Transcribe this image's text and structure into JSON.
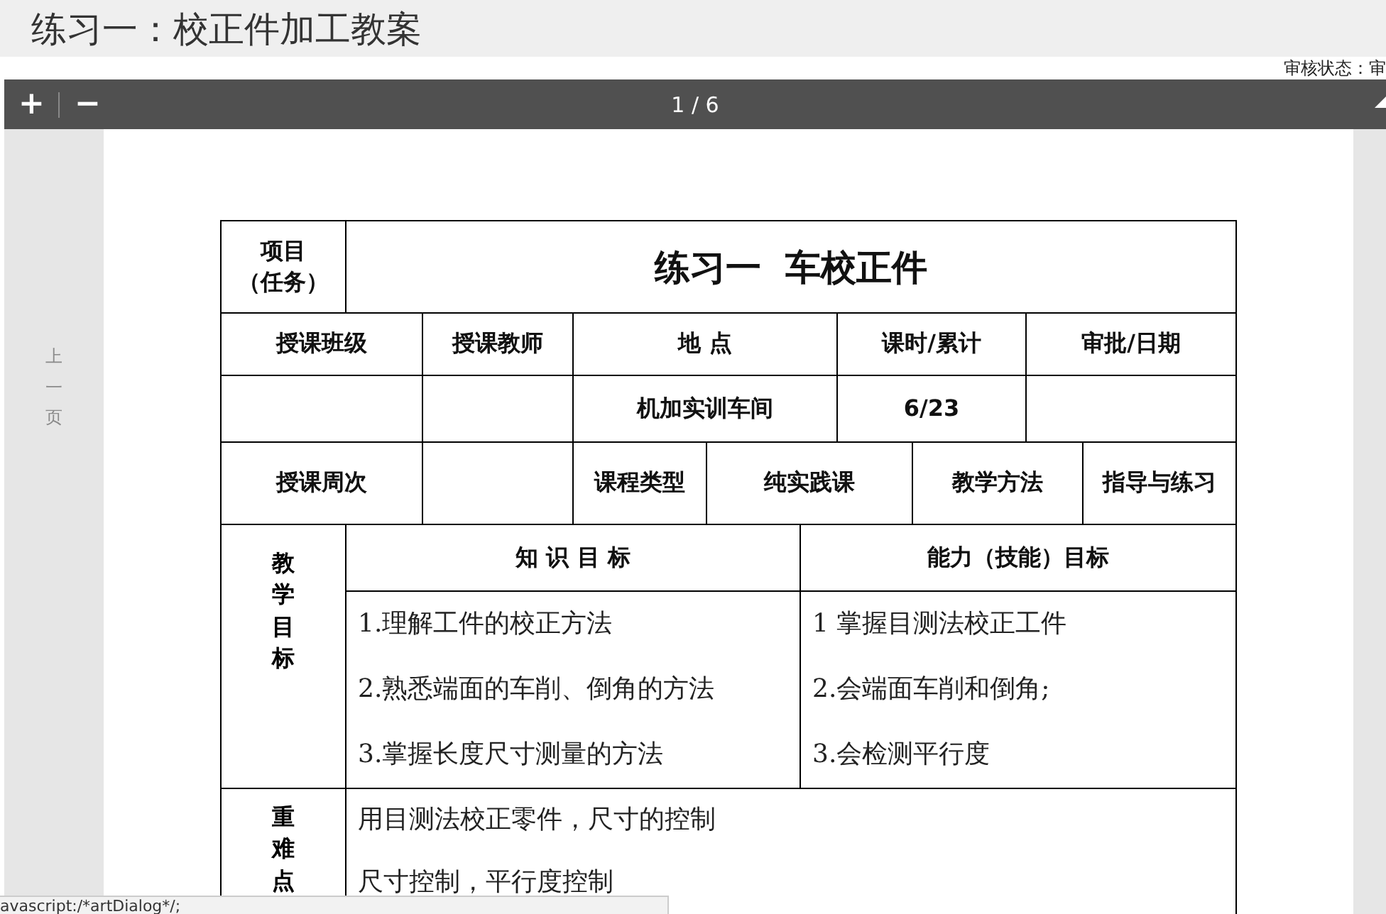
{
  "page_title": "练习一：校正件加工教案",
  "toolbar": {
    "zoom_in": "+",
    "zoom_out": "−",
    "page_indicator": "1 / 6"
  },
  "review_status": "审核状态：审",
  "prev_page": "上一页",
  "table": {
    "rows": [
      [
        {
          "kind": "stack",
          "lines": [
            "项目",
            "（任务）"
          ]
        },
        {
          "kind": "title",
          "text": "练习一  车校正件",
          "colspan": 9
        }
      ],
      [
        {
          "kind": "label",
          "text": "授课班级",
          "colspan": 2
        },
        {
          "kind": "label",
          "text": "授课教师"
        },
        {
          "kind": "label",
          "text": "地    点",
          "colspan": 3
        },
        {
          "kind": "label",
          "text": "课时/累计",
          "colspan": 2
        },
        {
          "kind": "label",
          "text": "审批/日期",
          "colspan": 2
        }
      ],
      [
        {
          "kind": "blank",
          "colspan": 2
        },
        {
          "kind": "blank"
        },
        {
          "kind": "label",
          "text": "机加实训车间",
          "colspan": 3
        },
        {
          "kind": "label",
          "text": "6/23",
          "colspan": 2
        },
        {
          "kind": "blank",
          "colspan": 2
        }
      ],
      [
        {
          "kind": "label",
          "text": "授课周次",
          "colspan": 2
        },
        {
          "kind": "blank"
        },
        {
          "kind": "label",
          "text": "课程类型"
        },
        {
          "kind": "label",
          "text": "纯实践课",
          "colspan": 3
        },
        {
          "kind": "label",
          "text": "教学方法",
          "colspan": 2
        },
        {
          "kind": "label",
          "text": "指导与练习"
        }
      ],
      [
        {
          "kind": "vertical",
          "text": "教学目标",
          "rowspan": 2
        },
        {
          "kind": "label",
          "text": "知 识 目 标",
          "colspan": 4
        },
        {
          "kind": "label",
          "text": "能力（技能）目标",
          "colspan": 5
        }
      ],
      [
        {
          "kind": "list",
          "lines": [
            "1.理解工件的校正方法",
            "2.熟悉端面的车削、倒角的方法",
            "3.掌握长度尺寸测量的方法"
          ],
          "colspan": 4
        },
        {
          "kind": "list",
          "lines": [
            "1 掌握目测法校正工件",
            "2.会端面车削和倒角;",
            "3.会检测平行度"
          ],
          "colspan": 5
        }
      ],
      [
        {
          "kind": "vertical",
          "text": "重难点"
        },
        {
          "kind": "list",
          "lines": [
            "用目测法校正零件，尺寸的控制",
            "尺寸控制，平行度控制"
          ],
          "colspan": 9
        }
      ]
    ]
  },
  "status_bar": "avascript:/*artDialog*/;"
}
